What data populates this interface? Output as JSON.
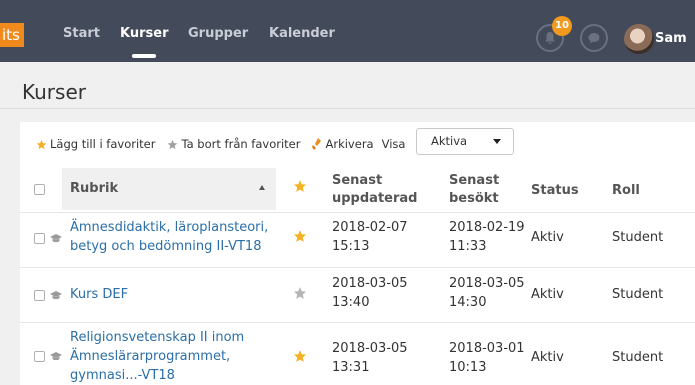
{
  "nav": {
    "logo": "its",
    "items": [
      "Start",
      "Kurser",
      "Grupper",
      "Kalender"
    ],
    "notification_count": "10",
    "user_name": "Sam"
  },
  "page": {
    "title": "Kurser"
  },
  "toolbar": {
    "add_favorite": "Lägg till i favoriter",
    "remove_favorite": "Ta bort från favoriter",
    "archive": "Arkivera",
    "show_label": "Visa",
    "filter_value": "Aktiva"
  },
  "table": {
    "headers": {
      "rubrik": "Rubrik",
      "updated": [
        "Senast",
        "uppdaterad"
      ],
      "visited": [
        "Senast",
        "besökt"
      ],
      "status": "Status",
      "role": "Roll"
    },
    "rows": [
      {
        "title_lines": [
          "Ämnesdidaktik, läroplansteori,",
          "betyg och bedömning II-VT18"
        ],
        "favorite": true,
        "updated": [
          "2018-02-07",
          "15:13"
        ],
        "visited": [
          "2018-02-19",
          "11:33"
        ],
        "status": "Aktiv",
        "role": "Student"
      },
      {
        "title_lines": [
          "Kurs DEF"
        ],
        "favorite": false,
        "updated": [
          "2018-03-05",
          "13:40"
        ],
        "visited": [
          "2018-03-05",
          "14:30"
        ],
        "status": "Aktiv",
        "role": "Student"
      },
      {
        "title_lines": [
          "Religionsvetenskap II inom",
          "Ämneslärarprogrammet,",
          "gymnasi...-VT18"
        ],
        "favorite": true,
        "updated": [
          "2018-03-05",
          "13:31"
        ],
        "visited": [
          "2018-03-01",
          "10:13"
        ],
        "status": "Aktiv",
        "role": "Student"
      }
    ]
  },
  "colors": {
    "nav_bg": "#434a5a",
    "accent_orange": "#f08a1c",
    "star_active": "#f5b324",
    "star_inactive": "#b5b5b5",
    "link": "#2b6ea8"
  }
}
